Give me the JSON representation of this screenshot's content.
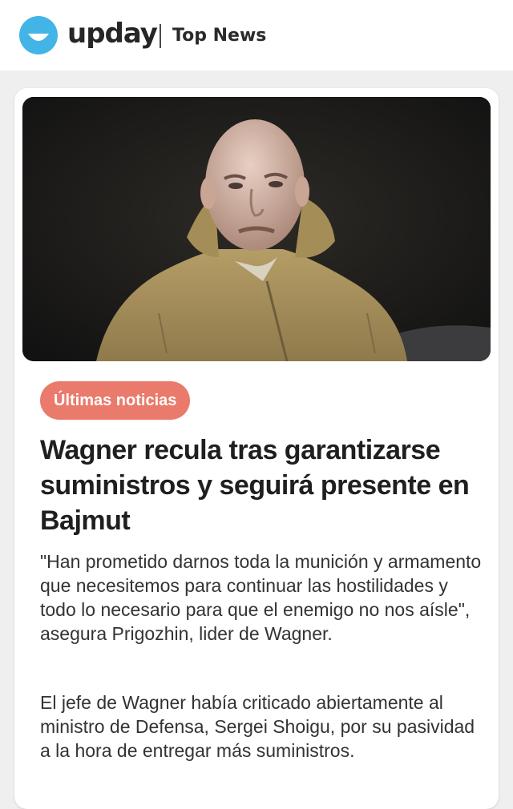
{
  "header": {
    "logo_icon": "smiley-logo-icon",
    "brand": "upday",
    "section": "Top News"
  },
  "colors": {
    "brand_blue": "#42b4e6",
    "tag_salmon": "#ea7a6b",
    "page_bg": "#efefef"
  },
  "article": {
    "image_description_icon": "news-photo",
    "tag": "Últimas noticias",
    "headline": "Wagner recula tras garantizarse suministros y seguirá presente en Bajmut",
    "paragraphs": [
      "\"Han prometido darnos toda la munición y armamento que necesitemos para continuar las hostilidades y todo lo necesario para que el enemigo no nos aísle\", asegura Prigozhin, lider de Wagner.",
      "El jefe de Wagner había criticado abiertamente al ministro de Defensa, Sergei Shoigu, por su pasividad a la hora de entregar más suministros."
    ]
  }
}
